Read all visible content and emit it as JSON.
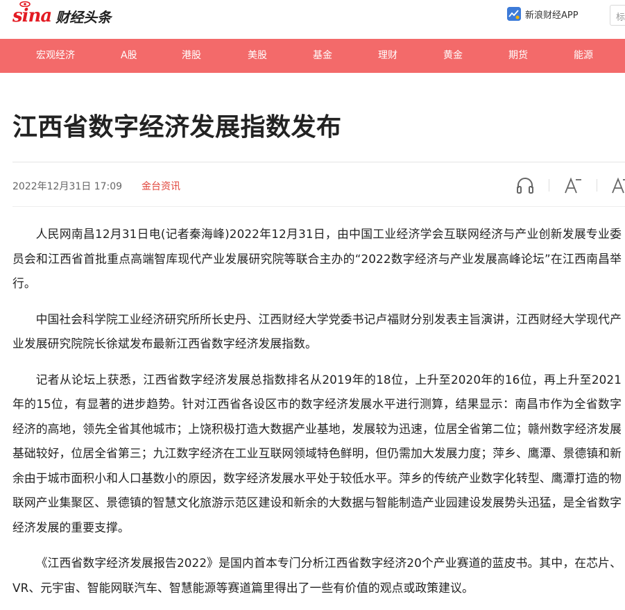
{
  "header": {
    "logo_text": "sina",
    "logo_subtitle": "财经头条",
    "app_link_label": "新浪财经APP",
    "search_placeholder": "标"
  },
  "nav": {
    "items": [
      {
        "label": "宏观经济"
      },
      {
        "label": "A股"
      },
      {
        "label": "港股"
      },
      {
        "label": "美股"
      },
      {
        "label": "基金"
      },
      {
        "label": "理财"
      },
      {
        "label": "黄金"
      },
      {
        "label": "期货"
      },
      {
        "label": "能源"
      }
    ]
  },
  "article": {
    "title": "江西省数字经济发展指数发布",
    "date": "2022年12月31日 17:09",
    "source": "金台资讯",
    "paragraphs": [
      "人民网南昌12月31日电(记者秦海峰)2022年12月31日，由中国工业经济学会互联网经济与产业创新发展专业委员会和江西省首批重点高端智库现代产业发展研究院等联合主办的“2022数字经济与产业发展高峰论坛”在江西南昌举行。",
      "中国社会科学院工业经济研究所所长史丹、江西财经大学党委书记卢福财分别发表主旨演讲，江西财经大学现代产业发展研究院院长徐斌发布最新江西省数字经济发展指数。",
      "记者从论坛上获悉，江西省数字经济发展总指数排名从2019年的18位，上升至2020年的16位，再上升至2021年的15位，有显著的进步趋势。针对江西省各设区市的数字经济发展水平进行测算，结果显示：南昌市作为全省数字经济的高地，领先全省其他城市；上饶积极打造大数据产业基地，发展较为迅速，位居全省第二位；赣州数字经济发展基础较好，位居全省第三；九江数字经济在工业互联网领域特色鲜明，但仍需加大发展力度；萍乡、鹰潭、景德镇和新余由于城市面积小和人口基数小的原因，数字经济发展水平处于较低水平。萍乡的传统产业数字化转型、鹰潭打造的物联网产业集聚区、景德镇的智慧文化旅游示范区建设和新余的大数据与智能制造产业园建设发展势头迅猛，是全省数字经济发展的重要支撑。",
      "《江西省数字经济发展报告2022》是国内首本专门分析江西省数字经济20个产业赛道的蓝皮书。其中，在芯片、VR、元宇宙、智能网联汽车、智慧能源等赛道篇里得出了一些有价值的观点或政策建议。"
    ]
  },
  "tools": {
    "audio_icon": "headphones-icon",
    "font_smaller_icon": "font-decrease-icon",
    "font_larger_icon": "font-increase-icon"
  },
  "colors": {
    "nav_bg": "#f36a6a",
    "brand_red": "#e31b23",
    "source_color": "#e0443a"
  }
}
